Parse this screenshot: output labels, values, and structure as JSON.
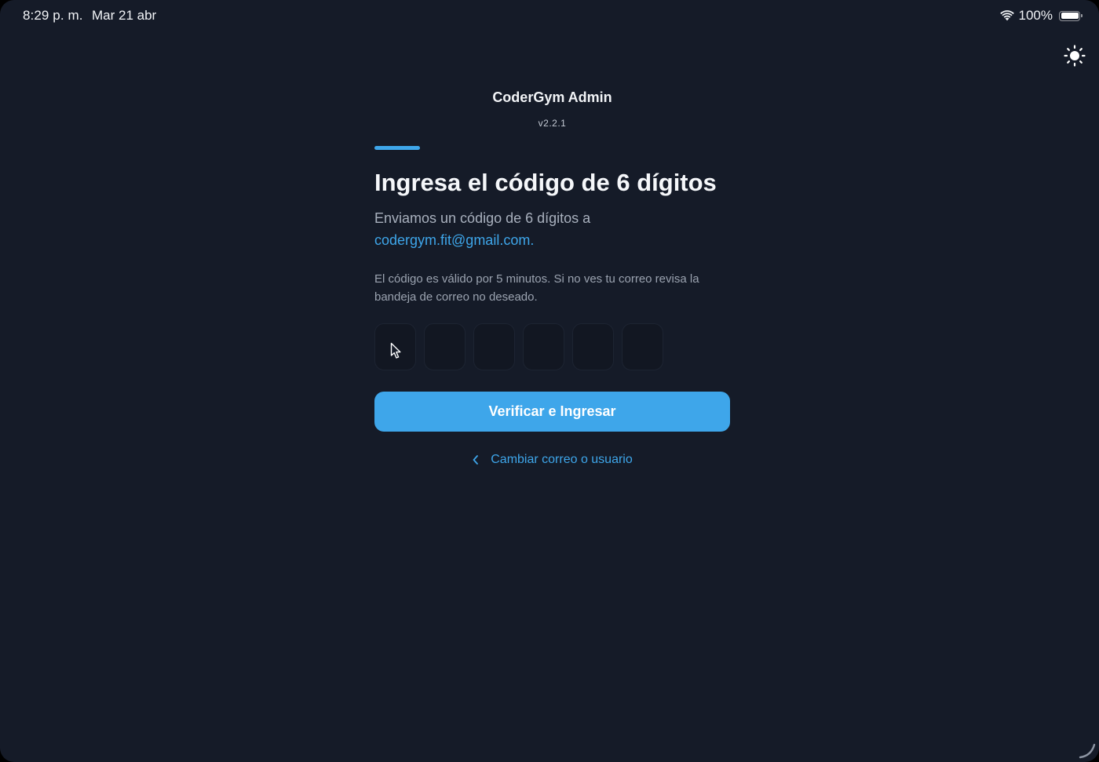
{
  "status_bar": {
    "time": "8:29 p. m.",
    "date": "Mar 21 abr",
    "battery": "100%",
    "battery_level": 1.0,
    "icons": [
      "wifi-icon",
      "battery-icon"
    ]
  },
  "header": {
    "theme_toggle_icon": "sun-icon",
    "app_title": "CoderGym Admin",
    "version": "v2.2.1"
  },
  "verification": {
    "heading": "Ingresa el código de 6 dígitos",
    "subtitle": "Enviamos un código de 6 dígitos a",
    "email": "codergym.fit@gmail.com.",
    "note": "El código es válido por 5 minutos. Si no ves tu correo revisa la bandeja de correo no deseado.",
    "code_digits": [
      "",
      "",
      "",
      "",
      "",
      ""
    ],
    "verify_button_label": "Verificar e Ingresar",
    "change_link_label": "Cambiar correo o usuario",
    "change_link_icon": "chevron-left-icon"
  },
  "colors": {
    "background": "#151b28",
    "accent": "#3ea6ea",
    "code_box": "#121722"
  }
}
